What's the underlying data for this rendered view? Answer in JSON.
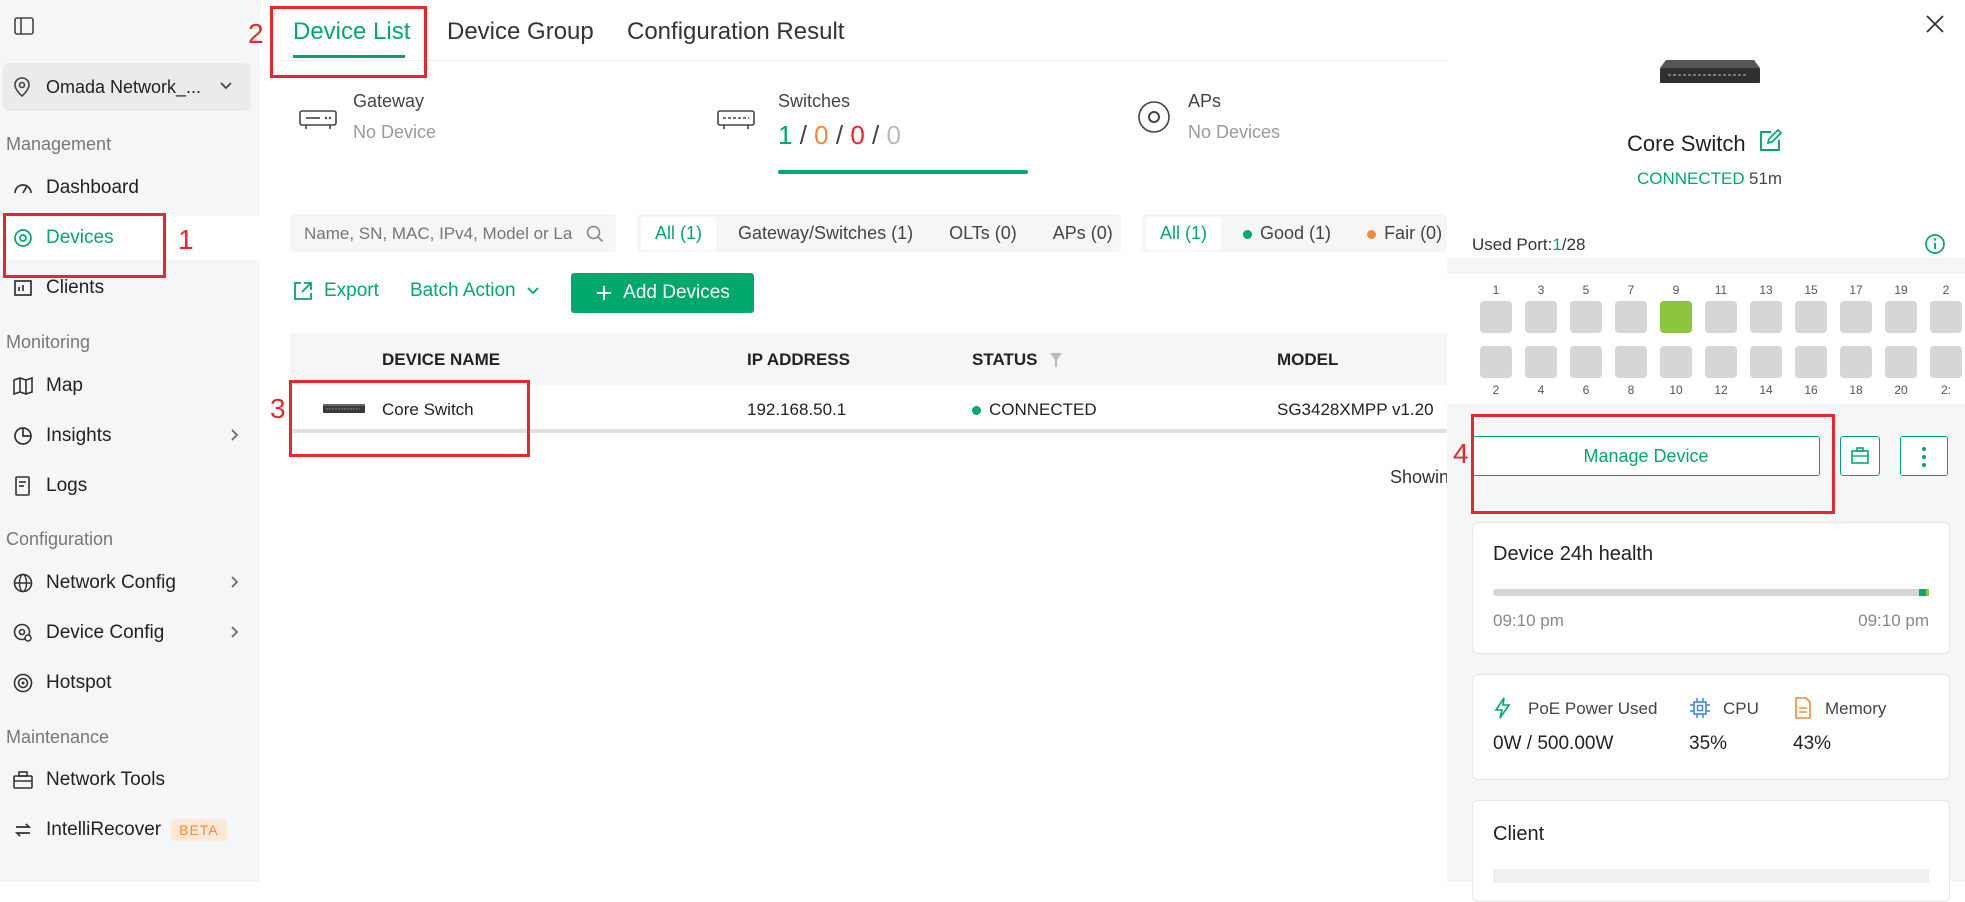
{
  "sidebar": {
    "site": "Omada Network_...",
    "sections": {
      "management": "Management",
      "monitoring": "Monitoring",
      "configuration": "Configuration",
      "maintenance": "Maintenance"
    },
    "items": {
      "dashboard": "Dashboard",
      "devices": "Devices",
      "clients": "Clients",
      "map": "Map",
      "insights": "Insights",
      "logs": "Logs",
      "network_config": "Network Config",
      "device_config": "Device Config",
      "hotspot": "Hotspot",
      "network_tools": "Network Tools",
      "intellirecover": "IntelliRecover",
      "beta": "BETA"
    }
  },
  "tabs": [
    "Device List",
    "Device Group",
    "Configuration Result"
  ],
  "stats": {
    "gateway": {
      "title": "Gateway",
      "sub": "No Device"
    },
    "switches": {
      "title": "Switches",
      "a": "1",
      "b": "0",
      "c": "0",
      "d": "0",
      "sep": "/"
    },
    "aps": {
      "title": "APs",
      "sub": "No Devices"
    }
  },
  "search": {
    "placeholder": "Name, SN, MAC, IPv4, Model or La..."
  },
  "filter_type": [
    "All (1)",
    "Gateway/Switches (1)",
    "OLTs (0)",
    "APs (0)"
  ],
  "filter_health": [
    "All (1)",
    "Good (1)",
    "Fair (0)"
  ],
  "actions": {
    "export": "Export",
    "batch": "Batch Action",
    "add": "Add Devices"
  },
  "table": {
    "columns": [
      "DEVICE NAME",
      "IP ADDRESS",
      "STATUS",
      "MODEL"
    ],
    "rows": [
      {
        "name": "Core Switch",
        "ip": "192.168.50.1",
        "status": "CONNECTED",
        "model": "SG3428XMPP v1.20"
      }
    ],
    "showing": "Showin"
  },
  "annotations": [
    "1",
    "2",
    "3",
    "4"
  ],
  "drawer": {
    "device_name": "Core Switch",
    "status": "CONNECTED",
    "uptime": "51m",
    "used_port_label": "Used Port:",
    "used_port_value": "1",
    "used_port_total": "/28",
    "ports_top": [
      "1",
      "3",
      "5",
      "7",
      "9",
      "11",
      "13",
      "15",
      "17",
      "19",
      "2"
    ],
    "ports_bottom": [
      "2",
      "4",
      "6",
      "8",
      "10",
      "12",
      "14",
      "16",
      "18",
      "20",
      "2:"
    ],
    "port_up": "9",
    "manage": "Manage Device",
    "health": {
      "title": "Device 24h health",
      "start": "09:10 pm",
      "end": "09:10 pm"
    },
    "metrics": [
      {
        "label": "PoE Power Used",
        "value": "0W / 500.00W"
      },
      {
        "label": "CPU",
        "value": "35%"
      },
      {
        "label": "Memory",
        "value": "43%"
      }
    ],
    "client_title": "Client"
  },
  "colors": {
    "accent": "#00a86b",
    "orange": "#f08a3c",
    "red": "#e8262e",
    "port_up": "#8cc63f"
  }
}
